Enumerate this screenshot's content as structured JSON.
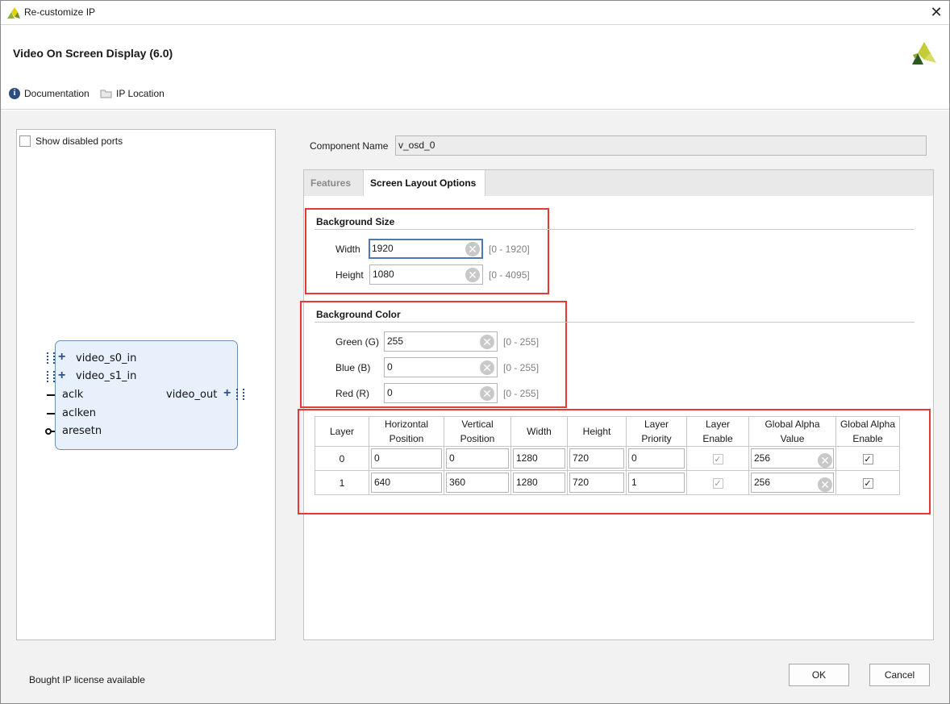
{
  "window": {
    "title": "Re-customize IP"
  },
  "header": {
    "ip_title": "Video On Screen Display (6.0)",
    "documentation": "Documentation",
    "ip_location": "IP Location"
  },
  "left": {
    "show_disabled_ports": "Show disabled ports",
    "ports_left": [
      "video_s0_in",
      "video_s1_in",
      "aclk",
      "aclken",
      "aresetn"
    ],
    "port_right": "video_out"
  },
  "component": {
    "label": "Component Name",
    "value": "v_osd_0"
  },
  "tabs": [
    "Features",
    "Screen Layout Options"
  ],
  "background_size": {
    "title": "Background Size",
    "fields": [
      {
        "label": "Width",
        "value": "1920",
        "range": "[0 - 1920]"
      },
      {
        "label": "Height",
        "value": "1080",
        "range": "[0 - 4095]"
      }
    ]
  },
  "background_color": {
    "title": "Background Color",
    "fields": [
      {
        "label": "Green (G)",
        "value": "255",
        "range": "[0 - 255]"
      },
      {
        "label": "Blue (B)",
        "value": "0",
        "range": "[0 - 255]"
      },
      {
        "label": "Red (R)",
        "value": "0",
        "range": "[0 - 255]"
      }
    ]
  },
  "layer_table": {
    "headers": [
      [
        "Layer"
      ],
      [
        "Horizontal",
        "Position"
      ],
      [
        "Vertical",
        "Position"
      ],
      [
        "Width"
      ],
      [
        "Height"
      ],
      [
        "Layer",
        "Priority"
      ],
      [
        "Layer",
        "Enable"
      ],
      [
        "Global Alpha",
        "Value"
      ],
      [
        "Global Alpha",
        "Enable"
      ]
    ],
    "rows": [
      {
        "layer": "0",
        "h_pos": "0",
        "v_pos": "0",
        "width": "1280",
        "height": "720",
        "priority": "0",
        "layer_enable": "✓",
        "alpha_value": "256",
        "alpha_enable": "✓"
      },
      {
        "layer": "1",
        "h_pos": "640",
        "v_pos": "360",
        "width": "1280",
        "height": "720",
        "priority": "1",
        "layer_enable": "✓",
        "alpha_value": "256",
        "alpha_enable": "✓"
      }
    ]
  },
  "footer": {
    "license": "Bought IP license available",
    "ok": "OK",
    "cancel": "Cancel"
  },
  "colors": {
    "highlight_box": "#e53935",
    "logo_dark": "#1f5e20",
    "logo_light": "#c9d44a"
  }
}
